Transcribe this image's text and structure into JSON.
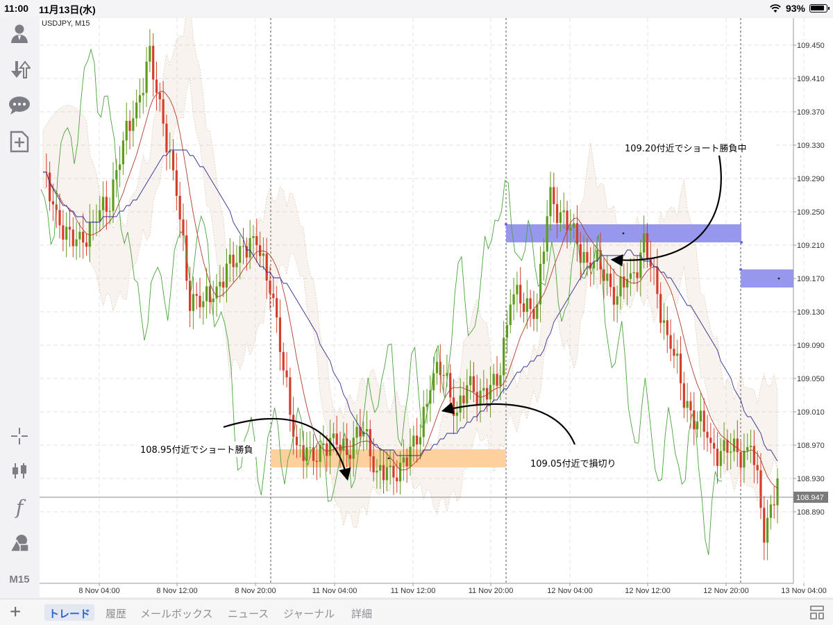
{
  "status_bar": {
    "time": "11:00",
    "date": "11月13日(水)",
    "battery": "93%"
  },
  "toolbar": {
    "icons": [
      "account-icon",
      "trade-arrows-icon",
      "chat-icon",
      "new-order-icon",
      "crosshair-icon",
      "candlestick-icon",
      "indicator-icon",
      "objects-icon"
    ],
    "timeframe": "M15",
    "indicator_glyph": "f"
  },
  "chart": {
    "title": "USDJPY, M15",
    "current_price": "108.947"
  },
  "chart_data": {
    "type": "line",
    "title": "USDJPY, M15",
    "ylim": [
      108.85,
      109.47
    ],
    "y_ticks": [
      "109.450",
      "109.410",
      "109.370",
      "109.330",
      "109.290",
      "109.250",
      "109.210",
      "109.170",
      "109.130",
      "109.090",
      "109.050",
      "109.010",
      "108.970",
      "108.930",
      "108.890"
    ],
    "x_ticks": [
      "8 Nov 04:00",
      "8 Nov 12:00",
      "8 Nov 20:00",
      "11 Nov 04:00",
      "11 Nov 12:00",
      "11 Nov 20:00",
      "12 Nov 04:00",
      "12 Nov 12:00",
      "12 Nov 20:00",
      "13 Nov 04:00"
    ],
    "grid": true,
    "series": [
      {
        "values": [
          109.29,
          109.25,
          109.21,
          109.22,
          109.24,
          109.27,
          109.33,
          109.38,
          109.43,
          109.36,
          109.27,
          109.15,
          109.14,
          109.16,
          109.18,
          109.21,
          109.21,
          109.17,
          109.06,
          108.97,
          108.95,
          108.97,
          108.97,
          108.97,
          108.99,
          108.94,
          108.93,
          108.95,
          108.97,
          109.05,
          109.06,
          109.01,
          109.04,
          109.03,
          109.04,
          109.15,
          109.14,
          109.14,
          109.27,
          109.24,
          109.21,
          109.19,
          109.18,
          109.15,
          109.17,
          109.21,
          109.15,
          109.09,
          109.03,
          109.0,
          108.97,
          108.96,
          108.96,
          108.97,
          108.87,
          108.93
        ]
      }
    ],
    "annotations": [
      {
        "text": "109.20付近でショート勝負中",
        "color": "#9797ee"
      },
      {
        "text": "108.95付近でショート勝負",
        "color": "#fdd09e"
      },
      {
        "text": "109.05付近で損切り"
      }
    ]
  },
  "tabs": [
    "トレード",
    "履歴",
    "メールボックス",
    "ニュース",
    "ジャーナル",
    "詳細"
  ],
  "colors": {
    "bull": "#5f9b1c",
    "bear": "#d43d2a",
    "kijun": "#2d2b94",
    "tenkan": "#b23a2a",
    "chikou": "#4aa33c",
    "cloud": "#c8a07a",
    "zone_blue": "#9797ee",
    "zone_orange": "#fdd09e",
    "accent": "#2a62c9"
  }
}
